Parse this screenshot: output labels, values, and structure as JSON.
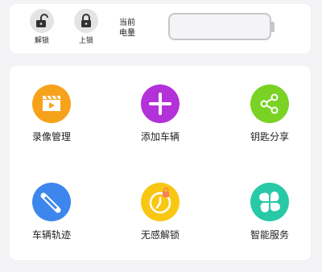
{
  "controls": {
    "unlock_label": "解锁",
    "lock_label": "上锁",
    "battery_label_line1": "当前",
    "battery_label_line2": "电量"
  },
  "features": [
    {
      "label": "录像管理",
      "icon": "video-clapper-icon",
      "color": "#f7a21b"
    },
    {
      "label": "添加车辆",
      "icon": "plus-icon",
      "color": "#b331d8"
    },
    {
      "label": "钥匙分享",
      "icon": "share-icon",
      "color": "#7ad224"
    },
    {
      "label": "车辆轨迹",
      "icon": "route-icon",
      "color": "#3d86ee"
    },
    {
      "label": "无感解锁",
      "icon": "proximity-unlock-icon",
      "color": "#f9c712"
    },
    {
      "label": "智能服务",
      "icon": "grid-petals-icon",
      "color": "#27c9a7"
    }
  ]
}
